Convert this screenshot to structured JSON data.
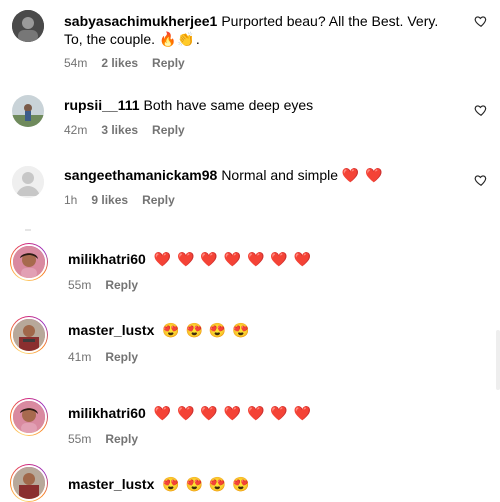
{
  "comments": [
    {
      "username": "sabyasachimukherjee1",
      "text": "Purported beau? All the Best. Very. To, the couple.",
      "emoji": "🔥👏.",
      "time": "54m",
      "likes": "2 likes",
      "reply": "Reply",
      "icon": "heart-outline-icon"
    },
    {
      "username": "rupsii__111",
      "text": "Both have same deep eyes",
      "time": "42m",
      "likes": "3 likes",
      "reply": "Reply",
      "icon": "heart-outline-icon"
    },
    {
      "username": "sangeethamanickam98",
      "text": "Normal and simple",
      "emoji": "❤️ ❤️",
      "time": "1h",
      "likes": "9 likes",
      "reply": "Reply",
      "icon": "heart-outline-icon"
    },
    {
      "username": "milikhatri60",
      "emoji": "❤️ ❤️ ❤️ ❤️ ❤️ ❤️ ❤️",
      "time": "55m",
      "reply": "Reply"
    },
    {
      "username": "master_lustx",
      "emoji": "😍 😍 😍 😍",
      "time": "41m",
      "reply": "Reply"
    },
    {
      "username": "milikhatri60",
      "emoji": "❤️ ❤️ ❤️ ❤️ ❤️ ❤️ ❤️",
      "time": "55m",
      "reply": "Reply"
    },
    {
      "username": "master_lustx",
      "emoji": "😍 😍 😍 😍"
    }
  ],
  "colors": {
    "meta": "#737373",
    "story_ring_start": "#feda75",
    "story_ring_end": "#d62976"
  }
}
